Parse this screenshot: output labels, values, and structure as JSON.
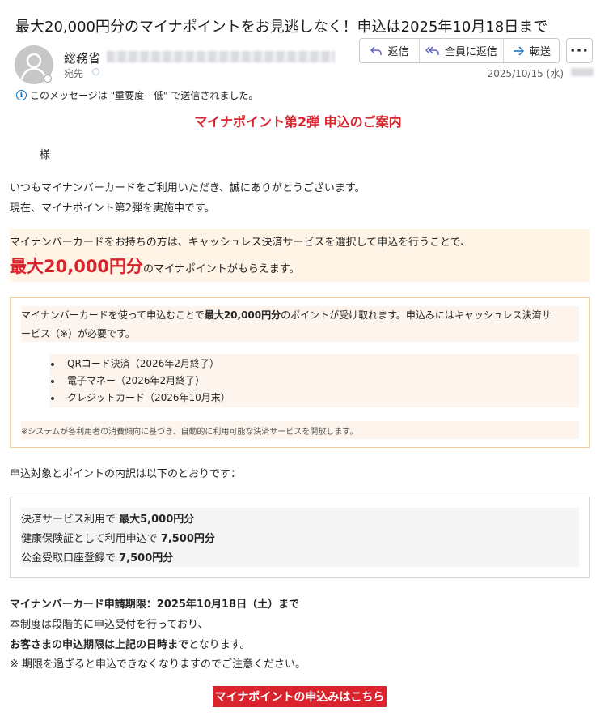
{
  "email": {
    "subject": "最大20,000円分のマイナポイントをお見逃しなく！申込は2025年10月18日まで",
    "sender": "総務省",
    "to_label": "宛先",
    "date": "2025/10/15 (水)",
    "importance_notice": "このメッセージは \"重要度 - 低\" で送信されました。"
  },
  "actions": {
    "reply": "返信",
    "reply_all": "全員に返信",
    "forward": "転送",
    "more": "···"
  },
  "body": {
    "heading": "マイナポイント第2弾 申込のご案内",
    "salutation": "様",
    "p1_line1": "いつもマイナンバーカードをご利用いただき、誠にありがとうございます。",
    "p1_line2": "現在、マイナポイント第2弾を実施中です。",
    "highlight_line1": "マイナンバーカードをお持ちの方は、キャッシュレス決済サービスを選択して申込を行うことで、",
    "highlight_amount": "最大20,000円分",
    "highlight_suffix": "のマイナポイントがもらえます。",
    "box1_line1_pre": "マイナンバーカードを使って申込むことで",
    "box1_line1_bold": "最大20,000円分",
    "box1_line1_post": "のポイントが受け取れます。申込みにはキャッシュレス決済サ",
    "box1_line2": "ービス（※）が必要です。",
    "methods": [
      "QRコード決済（2026年2月終了）",
      "電子マネー（2026年2月終了）",
      "クレジットカード（2026年10月末）"
    ],
    "box1_note": "※システムが各利用者の消費傾向に基づき、自動的に利用可能な決済サービスを開放します。",
    "breakdown_intro": "申込対象とポイントの内訳は以下のとおりです：",
    "breakdown": [
      {
        "label": "決済サービス利用で ",
        "value": "最大5,000円分"
      },
      {
        "label": "健康保険証として利用申込で ",
        "value": "7,500円分"
      },
      {
        "label": "公金受取口座登録で ",
        "value": "7,500円分"
      }
    ],
    "deadline": "マイナンバーカード申請期限：2025年10月18日（土）まで",
    "deadline_p1": "本制度は段階的に申込受付を行っており、",
    "deadline_p2_bold": "お客さまの申込期限は上記の日時まで",
    "deadline_p2_post": "となります。",
    "deadline_p3": "※ 期限を過ぎると申込できなくなりますのでご注意ください。",
    "cta": "マイナポイントの申込みはこちら"
  },
  "colors": {
    "accent_red": "#d9232d",
    "highlight_bg": "#fff4e6",
    "box_border": "#f2cda4",
    "action_icon": "#5b5fc7"
  }
}
